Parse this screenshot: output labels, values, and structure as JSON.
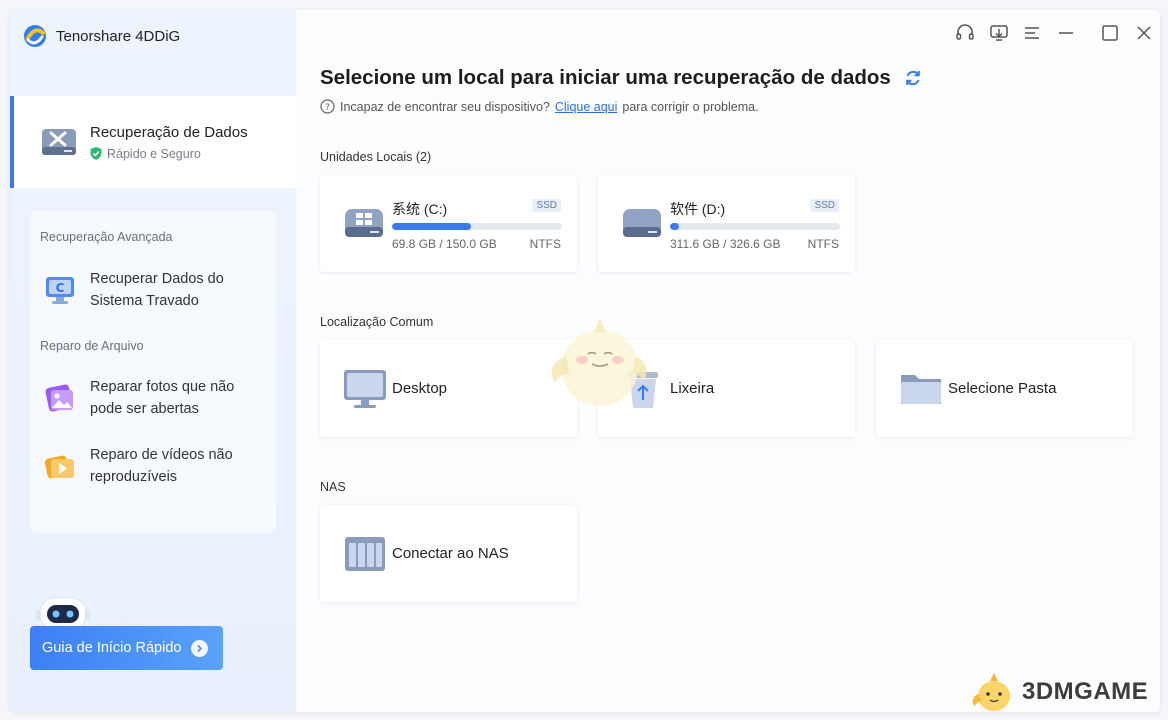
{
  "app": {
    "title": "Tenorshare 4DDiG"
  },
  "sidebar": {
    "main_item": {
      "title": "Recuperação de Dados",
      "subtitle": "Rápido e Seguro"
    },
    "sections": [
      {
        "heading": "Recuperação Avançada",
        "items": [
          {
            "label_line1": "Recuperar Dados do",
            "label_line2": "Sistema Travado"
          }
        ]
      },
      {
        "heading": "Reparo de Arquivo",
        "items": [
          {
            "label_line1": "Reparar fotos que não",
            "label_line2": "pode ser abertas"
          },
          {
            "label_line1": "Reparo de vídeos não",
            "label_line2": "reproduzíveis"
          }
        ]
      }
    ],
    "quick_guide_label": "Guia de Início Rápido"
  },
  "main": {
    "title": "Selecione um local para iniciar uma recuperação de dados",
    "hint_before": "Incapaz de encontrar seu dispositivo?",
    "hint_link": "Clique aqui",
    "hint_after": "para corrigir o problema.",
    "local_drives_label": "Unidades Locais (2)",
    "drives": [
      {
        "name": "系统 (C:)",
        "type": "SSD",
        "size": "69.8 GB / 150.0 GB",
        "fs": "NTFS",
        "used_fraction": 0.465
      },
      {
        "name": "软件 (D:)",
        "type": "SSD",
        "size": "311.6 GB / 326.6 GB",
        "fs": "NTFS",
        "used_fraction": 0.05
      }
    ],
    "common_label": "Localização Comum",
    "common": [
      {
        "label": "Desktop"
      },
      {
        "label": "Lixeira"
      },
      {
        "label": "Selecione Pasta"
      }
    ],
    "nas_label": "NAS",
    "nas": {
      "label": "Conectar ao NAS"
    }
  },
  "watermark": {
    "text": "3DMGAME"
  },
  "colors": {
    "accent": "#3a7af0",
    "link": "#2f6fe8",
    "sidebar_bg": "#eaf2fd"
  }
}
